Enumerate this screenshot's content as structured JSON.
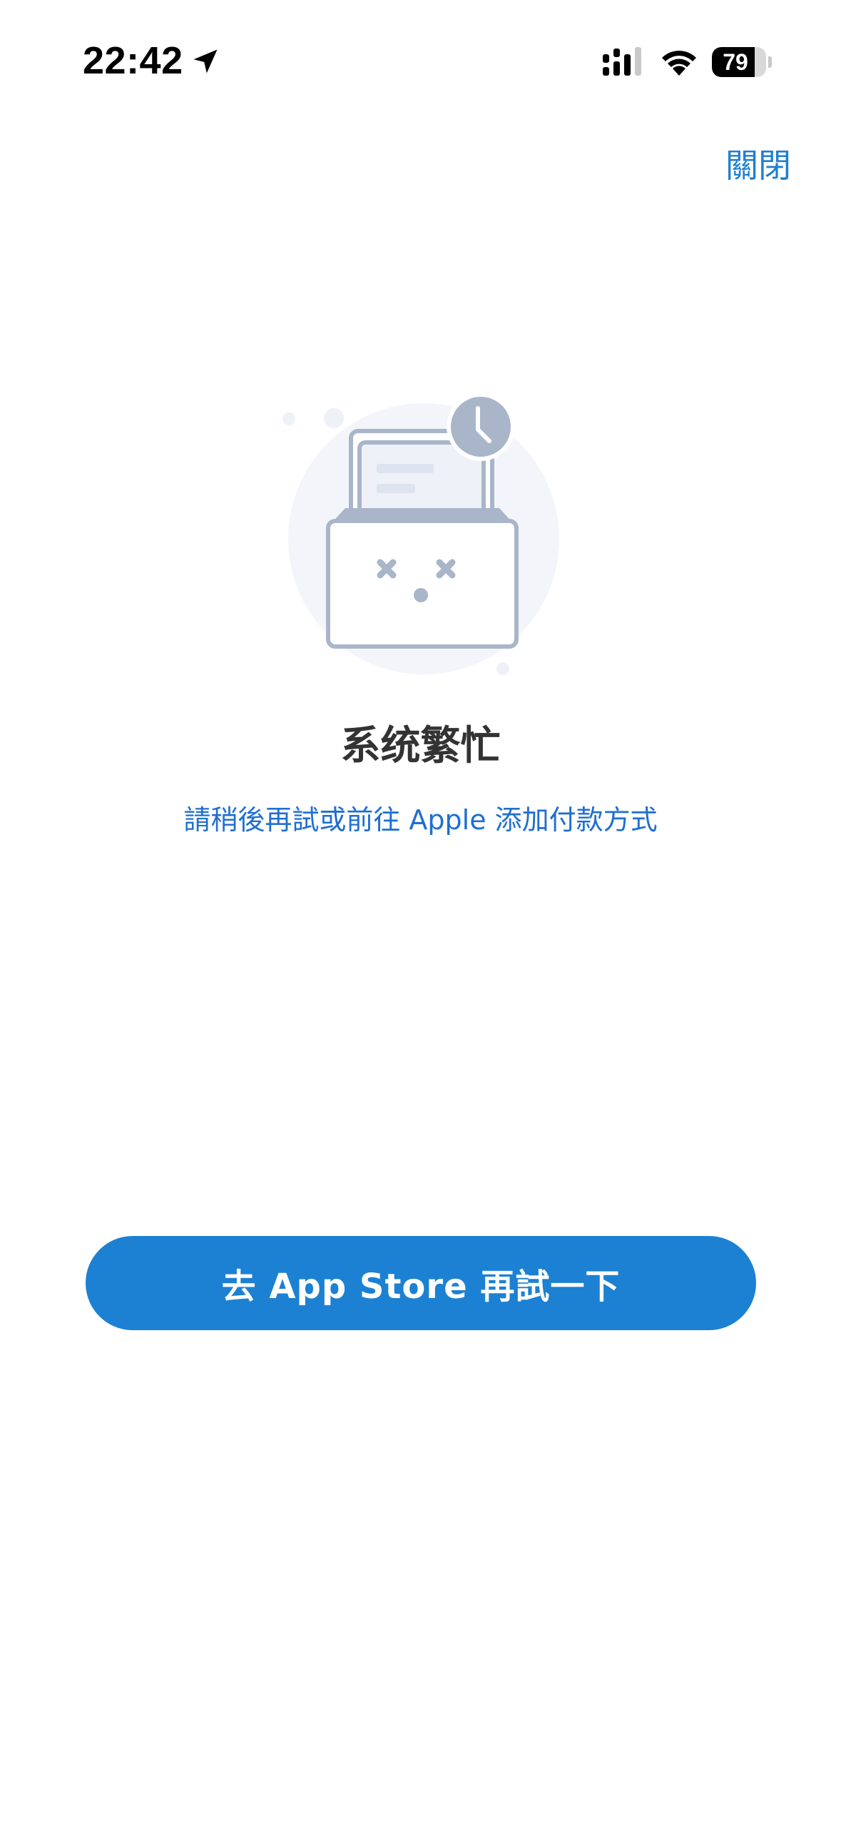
{
  "status_bar": {
    "time": "22:42",
    "battery_level": "79",
    "battery_fraction": 0.79,
    "icons": [
      "location-arrow-icon",
      "cellular-signal-icon",
      "wifi-icon",
      "battery-icon"
    ]
  },
  "header": {
    "close_label": "關閉"
  },
  "illustration": {
    "icon": "busy-box-with-clock-illustration"
  },
  "message": {
    "title": "系统繁忙",
    "subtitle": "請稍後再試或前往 Apple 添加付款方式"
  },
  "actions": {
    "primary_label": "去 App Store 再試一下"
  },
  "colors": {
    "accent": "#1c81d2",
    "link": "#1f7fd0",
    "title_text": "#333333",
    "illustration_gray": "#a9b6c9",
    "illustration_bg": "#f3f5fa"
  }
}
